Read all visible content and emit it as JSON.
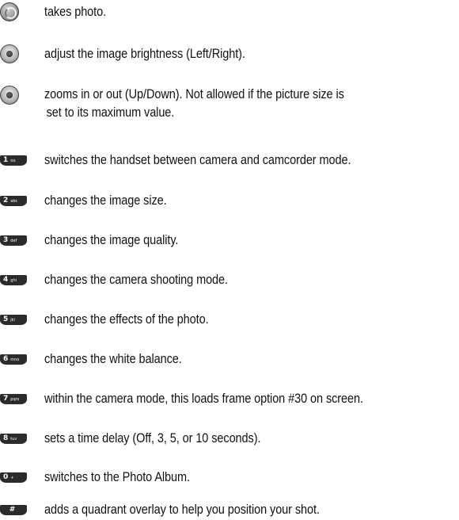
{
  "colors": {
    "text": "#111111",
    "key_fill": "#2b2b2b",
    "background": "#ffffff"
  },
  "items": [
    {
      "icon": "camera-key-icon",
      "key_main": "",
      "key_sub": "",
      "lines": [
        "takes photo."
      ]
    },
    {
      "icon": "navigation-key-left-right-icon",
      "key_main": "",
      "key_sub": "",
      "lines": [
        "adjust the image brightness (Left/Right)."
      ]
    },
    {
      "icon": "navigation-key-up-down-icon",
      "key_main": "",
      "key_sub": "",
      "lines": [
        "zooms in or out (Up/Down). Not allowed if the picture size is",
        "set to its maximum value."
      ]
    },
    {
      "icon": "key-1-icon",
      "key_main": "1",
      "key_sub": "oo",
      "lines": [
        "switches the handset between camera and camcorder mode."
      ]
    },
    {
      "icon": "key-2-icon",
      "key_main": "2",
      "key_sub": "abc",
      "lines": [
        "changes the image size."
      ]
    },
    {
      "icon": "key-3-icon",
      "key_main": "3",
      "key_sub": "def",
      "lines": [
        "changes the image quality."
      ]
    },
    {
      "icon": "key-4-icon",
      "key_main": "4",
      "key_sub": "ghi",
      "lines": [
        "changes the camera shooting mode."
      ]
    },
    {
      "icon": "key-5-icon",
      "key_main": "5",
      "key_sub": "jkl",
      "lines": [
        "changes the effects of the photo."
      ]
    },
    {
      "icon": "key-6-icon",
      "key_main": "6",
      "key_sub": "mno",
      "lines": [
        "changes the white balance."
      ]
    },
    {
      "icon": "key-7-icon",
      "key_main": "7",
      "key_sub": "pqrs",
      "lines": [
        "within the camera mode, this loads frame option #30 on screen."
      ]
    },
    {
      "icon": "key-8-icon",
      "key_main": "8",
      "key_sub": "tuv",
      "lines": [
        "sets a time delay (Off, 3, 5, or 10 seconds)."
      ]
    },
    {
      "icon": "key-0-icon",
      "key_main": "0",
      "key_sub": "+",
      "lines": [
        "switches to the Photo Album."
      ]
    },
    {
      "icon": "key-pound-icon",
      "key_main": "#",
      "key_sub": "",
      "lines": [
        "adds a quadrant overlay to help you position your shot."
      ]
    }
  ]
}
